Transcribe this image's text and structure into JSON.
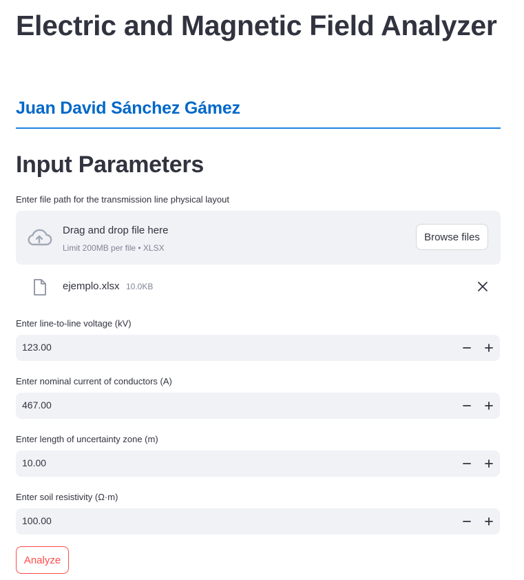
{
  "header": {
    "title": "Electric and Magnetic Field Analyzer",
    "author": "Juan David Sánchez Gámez"
  },
  "inputs": {
    "section_title": "Input Parameters",
    "file_uploader": {
      "label": "Enter file path for the transmission line physical layout",
      "drop_text": "Drag and drop file here",
      "limit_text": "Limit 200MB per file • XLSX",
      "browse_label": "Browse files",
      "icon": "cloud-upload-icon",
      "uploaded_file": {
        "name": "ejemplo.xlsx",
        "size": "10.0KB",
        "icon": "file-icon",
        "remove_icon": "close-icon"
      }
    },
    "fields": [
      {
        "label": "Enter line-to-line voltage (kV)",
        "value": "123.00"
      },
      {
        "label": "Enter nominal current of conductors (A)",
        "value": "467.00"
      },
      {
        "label": "Enter length of uncertainty zone (m)",
        "value": "10.00"
      },
      {
        "label": "Enter soil resistivity (Ω·m)",
        "value": "100.00"
      }
    ],
    "stepper_icons": [
      "minus-icon",
      "plus-icon"
    ]
  },
  "actions": {
    "analyze_label": "Analyze"
  },
  "colors": {
    "text": "#31333f",
    "author_link": "#0068c9",
    "divider": "#1c83e1",
    "input_bg": "#f0f2f6",
    "muted": "#808495",
    "primary": "#ff4b4b"
  }
}
